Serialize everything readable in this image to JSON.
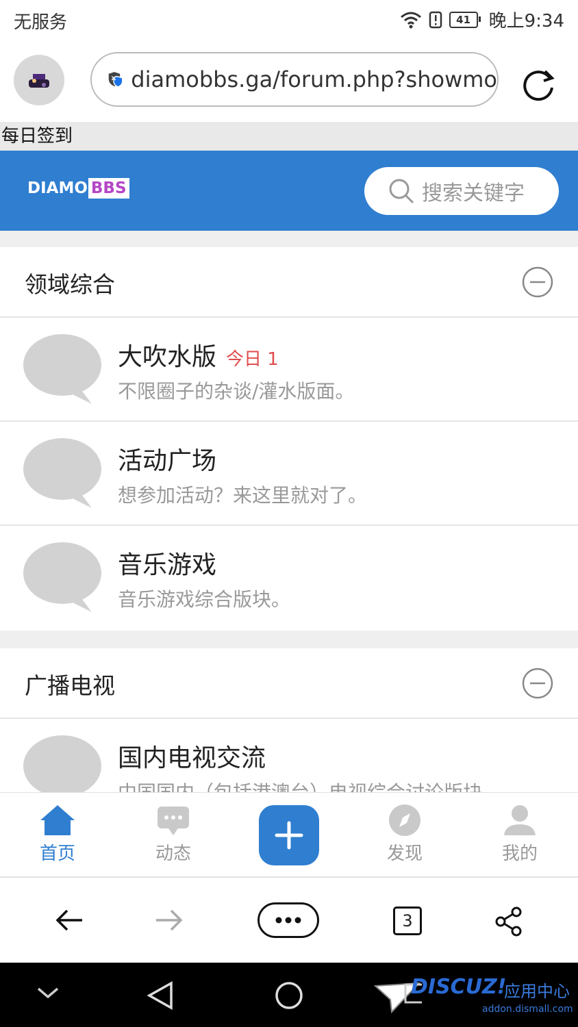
{
  "status_bar": {
    "carrier": "无服务",
    "battery": "41",
    "time": "晚上9:34"
  },
  "browser": {
    "url": "diamobbs.ga/forum.php?showmo"
  },
  "checkin": {
    "label": "每日签到"
  },
  "site_header": {
    "logo_left": "DIAMO",
    "logo_right": "BBS",
    "search_placeholder": "搜索关键字",
    "brand_color": "#2f7ed0"
  },
  "sections": [
    {
      "title": "领域综合",
      "forums": [
        {
          "name": "大吹水版",
          "badge": "今日 1",
          "desc": "不限圈子的杂谈/灌水版面。"
        },
        {
          "name": "活动广场",
          "desc": "想参加活动？来这里就对了。"
        },
        {
          "name": "音乐游戏",
          "desc": "音乐游戏综合版块。"
        }
      ]
    },
    {
      "title": "广播电视",
      "forums": [
        {
          "name": "国内电视交流",
          "desc": "中国国内（包括港澳台）电视综合讨论版块"
        }
      ]
    }
  ],
  "app_nav": {
    "items": [
      {
        "label": "首页",
        "icon": "home-icon",
        "active": true
      },
      {
        "label": "动态",
        "icon": "chat-icon"
      },
      {
        "label": "发现",
        "icon": "compass-icon"
      },
      {
        "label": "我的",
        "icon": "user-icon"
      }
    ]
  },
  "browser_toolbar": {
    "tab_count": "3"
  },
  "watermark": {
    "brand": "DISCUZ!",
    "cn": "应用中心",
    "url": "addon.dismall.com"
  }
}
